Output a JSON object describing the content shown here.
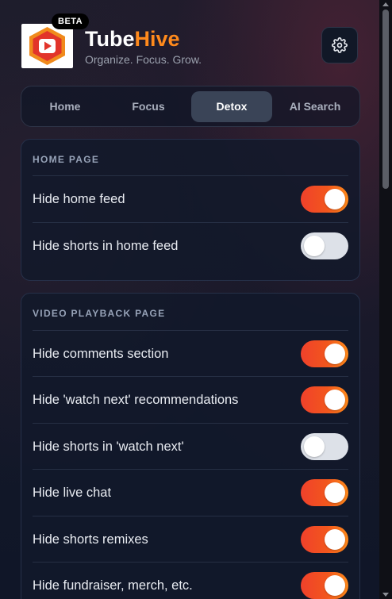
{
  "brand": {
    "name_part1": "Tube",
    "name_part2": "Hive",
    "tagline": "Organize. Focus. Grow.",
    "badge": "BETA",
    "accent_color": "#ff8a1c"
  },
  "header": {
    "settings_icon": "gear-icon"
  },
  "tabs": [
    {
      "label": "Home",
      "active": false
    },
    {
      "label": "Focus",
      "active": false
    },
    {
      "label": "Detox",
      "active": true
    },
    {
      "label": "AI Search",
      "active": false
    }
  ],
  "sections": [
    {
      "title": "HOME PAGE",
      "items": [
        {
          "label": "Hide home feed",
          "enabled": true
        },
        {
          "label": "Hide shorts in home feed",
          "enabled": false
        }
      ]
    },
    {
      "title": "VIDEO PLAYBACK PAGE",
      "items": [
        {
          "label": "Hide comments section",
          "enabled": true
        },
        {
          "label": "Hide 'watch next' recommendations",
          "enabled": true
        },
        {
          "label": "Hide shorts in 'watch next'",
          "enabled": false
        },
        {
          "label": "Hide live chat",
          "enabled": true
        },
        {
          "label": "Hide shorts remixes",
          "enabled": true
        },
        {
          "label": "Hide fundraiser, merch, etc.",
          "enabled": true
        }
      ]
    }
  ],
  "colors": {
    "toggle_on_start": "#f0412b",
    "toggle_on_end": "#ff8a1a",
    "toggle_off": "#dde1e8",
    "active_tab": "#3a4457"
  }
}
